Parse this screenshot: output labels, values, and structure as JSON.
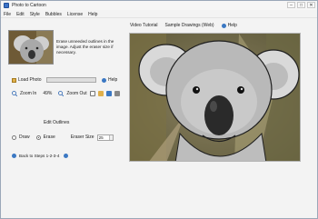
{
  "window": {
    "title": "Photo to Cartoon",
    "controls": {
      "minimize": "–",
      "maximize": "□",
      "close": "✕"
    }
  },
  "menu": [
    "File",
    "Edit",
    "Style",
    "Bubbles",
    "License",
    "Help"
  ],
  "instructions": "Erase unneeded outlines in the image. Adjust the eraser size if necessary.",
  "toolbar": {
    "load_photo": "Load Photo",
    "help": "Help",
    "zoom_in": "Zoom In",
    "zoom_percent": "49%",
    "zoom_out": "Zoom Out"
  },
  "edit_outlines": {
    "title": "Edit Outlines",
    "draw": "Draw",
    "erase": "Erase",
    "selected_mode": "Erase",
    "eraser_size_label": "Eraser Size",
    "eraser_size_value": "25"
  },
  "back_to_steps": "Back to Steps 1-2-3-4",
  "top_links": {
    "video_tutorial": "Video Tutorial",
    "sample_drawings": "Sample Drawings (Web)",
    "help": "Help"
  },
  "colors": {
    "accent": "#3b78c3",
    "progress_track": "#dedede"
  },
  "icons": {
    "load": "folder-icon",
    "help": "help-circle-icon",
    "zoom_in": "magnifier-plus-icon",
    "zoom_out": "magnifier-minus-icon",
    "back": "back-circle-icon"
  }
}
